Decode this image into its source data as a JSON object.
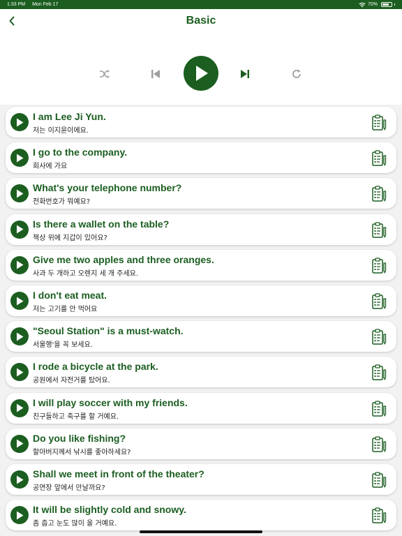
{
  "status_bar": {
    "time": "1:33 PM",
    "date": "Mon Feb 17",
    "battery": "70%"
  },
  "header": {
    "title": "Basic"
  },
  "icons": {
    "back": "chevron-left-icon",
    "shuffle": "shuffle-icon",
    "previous": "skip-previous-icon",
    "play": "play-icon",
    "next": "skip-next-icon",
    "repeat": "repeat-icon",
    "copy": "clipboard-icon"
  },
  "colors": {
    "accent": "#1b5e20",
    "disabled": "#9e9e9e"
  },
  "phrases": [
    {
      "en": "I am Lee Ji Yun.",
      "ko": "저는 이지윤이에요."
    },
    {
      "en": "I go to the company.",
      "ko": "회사에 가요"
    },
    {
      "en": "What's your telephone number?",
      "ko": "전화번호가 뭐예요?"
    },
    {
      "en": "Is there a wallet on the table?",
      "ko": "책상 위에 지갑이 있어요?"
    },
    {
      "en": "Give me two apples and three oranges.",
      "ko": "사과 두 개하고 오렌지 세 개 주세요."
    },
    {
      "en": "I don't eat meat.",
      "ko": "저는 고기를 안 먹어요"
    },
    {
      "en": "\"Seoul Station\" is a must-watch.",
      "ko": "서울행'을 꼭 보세요."
    },
    {
      "en": "I rode a bicycle at the park.",
      "ko": "공원에서 자전거를 탔어요."
    },
    {
      "en": "I will play soccer with my friends.",
      "ko": "친구들하고 축구를 할 거예요."
    },
    {
      "en": "Do you like fishing?",
      "ko": "할아버지께서 낚시를 좋아하세요?"
    },
    {
      "en": "Shall we meet in front of the theater?",
      "ko": "공연장 앞에서 만날까요?"
    },
    {
      "en": "It will be slightly cold and snowy.",
      "ko": "좀 춥고 눈도 많이 올 거예요."
    }
  ]
}
